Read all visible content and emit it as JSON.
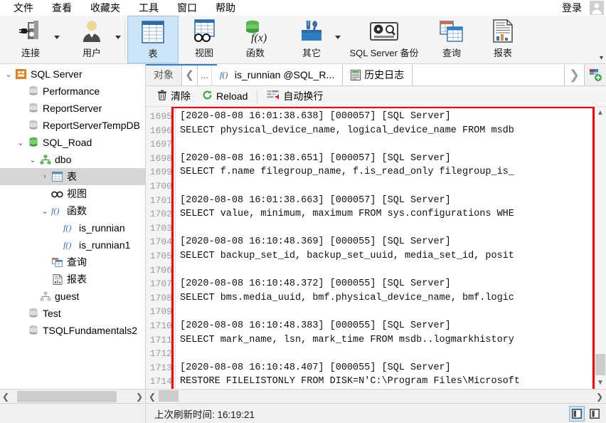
{
  "menubar": {
    "items": [
      {
        "label": "文件",
        "name": "menu-file"
      },
      {
        "label": "查看",
        "name": "menu-view"
      },
      {
        "label": "收藏夹",
        "name": "menu-favorites"
      },
      {
        "label": "工具",
        "name": "menu-tools"
      },
      {
        "label": "窗口",
        "name": "menu-window"
      },
      {
        "label": "帮助",
        "name": "menu-help"
      }
    ],
    "login_label": "登录",
    "avatar_icon": "user-avatar-icon"
  },
  "ribbon": {
    "more_glyph": "▾",
    "overflow_glyph": "»",
    "items": [
      {
        "label": "连接",
        "icon": "connect-plug-icon",
        "caret": true,
        "selected": false,
        "name": "ribbon-connect"
      },
      {
        "label": "用户",
        "icon": "user-icon",
        "caret": true,
        "selected": false,
        "name": "ribbon-user"
      },
      {
        "label": "表",
        "icon": "table-icon",
        "caret": false,
        "selected": true,
        "name": "ribbon-table"
      },
      {
        "label": "视图",
        "icon": "view-icon",
        "caret": false,
        "selected": false,
        "name": "ribbon-view"
      },
      {
        "label": "函数",
        "icon": "function-icon",
        "caret": false,
        "selected": false,
        "name": "ribbon-function"
      },
      {
        "label": "其它",
        "icon": "tools-other-icon",
        "caret": true,
        "selected": false,
        "name": "ribbon-other"
      },
      {
        "label": "SQL Server 备份",
        "icon": "backup-tape-icon",
        "caret": false,
        "selected": false,
        "name": "ribbon-sqlserver-backup"
      },
      {
        "label": "查询",
        "icon": "query-icon",
        "caret": false,
        "selected": false,
        "name": "ribbon-query"
      },
      {
        "label": "报表",
        "icon": "report-icon",
        "caret": false,
        "selected": false,
        "name": "ribbon-report"
      }
    ]
  },
  "tree": {
    "nodes": [
      {
        "label": "SQL Server",
        "indent": 0,
        "twisty": "⌄",
        "icon": "sqlserver-icon",
        "selected": false,
        "name": "tree-node-sql-server"
      },
      {
        "label": "Performance",
        "indent": 1,
        "twisty": "",
        "icon": "database-icon",
        "selected": false,
        "name": "tree-node-performance"
      },
      {
        "label": "ReportServer",
        "indent": 1,
        "twisty": "",
        "icon": "database-icon",
        "selected": false,
        "name": "tree-node-reportserver"
      },
      {
        "label": "ReportServerTempDB",
        "indent": 1,
        "twisty": "",
        "icon": "database-icon",
        "selected": false,
        "name": "tree-node-reportservertempdb"
      },
      {
        "label": "SQL_Road",
        "indent": 1,
        "twisty": "⌄",
        "icon": "database-green-icon",
        "selected": false,
        "name": "tree-node-sql-road"
      },
      {
        "label": "dbo",
        "indent": 2,
        "twisty": "⌄",
        "icon": "schema-icon",
        "selected": false,
        "name": "tree-node-dbo"
      },
      {
        "label": "表",
        "indent": 3,
        "twisty": "›",
        "icon": "table-small-icon",
        "selected": true,
        "name": "tree-node-tables"
      },
      {
        "label": "视图",
        "indent": 3,
        "twisty": "",
        "icon": "view-small-icon",
        "selected": false,
        "name": "tree-node-views"
      },
      {
        "label": "函数",
        "indent": 3,
        "twisty": "⌄",
        "icon": "fx-icon",
        "selected": false,
        "name": "tree-node-functions"
      },
      {
        "label": "is_runnian",
        "indent": 4,
        "twisty": "",
        "icon": "fx-icon",
        "selected": false,
        "name": "tree-node-is-runnian"
      },
      {
        "label": "is_runnian1",
        "indent": 4,
        "twisty": "",
        "icon": "fx-icon",
        "selected": false,
        "name": "tree-node-is-runnian1"
      },
      {
        "label": "查询",
        "indent": 3,
        "twisty": "",
        "icon": "query-small-icon",
        "selected": false,
        "name": "tree-node-queries"
      },
      {
        "label": "报表",
        "indent": 3,
        "twisty": "",
        "icon": "report-small-icon",
        "selected": false,
        "name": "tree-node-reports"
      },
      {
        "label": "guest",
        "indent": 2,
        "twisty": "",
        "icon": "schema-gray-icon",
        "selected": false,
        "name": "tree-node-guest"
      },
      {
        "label": "Test",
        "indent": 1,
        "twisty": "",
        "icon": "database-icon",
        "selected": false,
        "name": "tree-node-test"
      },
      {
        "label": "TSQLFundamentals2",
        "indent": 1,
        "twisty": "",
        "icon": "database-icon",
        "selected": false,
        "name": "tree-node-tsqlfundamentals2"
      }
    ]
  },
  "tabs": {
    "object_tab": "对象",
    "prev_glyph": "❮",
    "ellipsis": "...",
    "fx_tab": "is_runnian @SQL_R...",
    "log_tab": "历史日志",
    "next_glyph": "❯",
    "add_icon": "add-tab-icon"
  },
  "log_toolbar": {
    "clear_label": "清除",
    "clear_icon": "trash-icon",
    "reload_label": "Reload",
    "reload_icon": "refresh-icon",
    "wrap_label": "自动换行",
    "wrap_icon": "word-wrap-icon"
  },
  "log": {
    "first_line_number": 1695,
    "line_numbers": [
      1695,
      1696,
      1697,
      1698,
      1699,
      1700,
      1701,
      1702,
      1703,
      1704,
      1705,
      1706,
      1707,
      1708,
      1709,
      1710,
      1711,
      1712,
      1713,
      1714
    ],
    "lines": [
      "[2020-08-08 16:01:38.638] [000057] [SQL Server]",
      "SELECT physical_device_name, logical_device_name FROM msdb",
      "",
      "[2020-08-08 16:01:38.651] [000057] [SQL Server]",
      "SELECT f.name filegroup_name, f.is_read_only filegroup_is_",
      "",
      "[2020-08-08 16:01:38.663] [000057] [SQL Server]",
      "SELECT value, minimum, maximum FROM sys.configurations WHE",
      "",
      "[2020-08-08 16:10:48.369] [000055] [SQL Server]",
      "SELECT backup_set_id, backup_set_uuid, media_set_id, posit",
      "",
      "[2020-08-08 16:10:48.372] [000055] [SQL Server]",
      "SELECT bms.media_uuid, bmf.physical_device_name, bmf.logic",
      "",
      "[2020-08-08 16:10:48.383] [000055] [SQL Server]",
      "SELECT mark_name, lsn, mark_time FROM msdb..logmarkhistory",
      "",
      "[2020-08-08 16:10:48.407] [000055] [SQL Server]",
      "RESTORE FILELISTONLY FROM DISK=N'C:\\Program Files\\Microsoft"
    ],
    "annotation_color": "#ff0000"
  },
  "statusbar": {
    "refresh_text": "上次刷新时间: 16:19:21",
    "panel_left_icon": "panel-left-toggle-icon",
    "panel_right_icon": "panel-right-toggle-icon"
  },
  "colors": {
    "accent": "#2d7fd3",
    "selection": "#cce4f7",
    "annotation": "#ff0000",
    "chrome": "#f5f5f5"
  }
}
